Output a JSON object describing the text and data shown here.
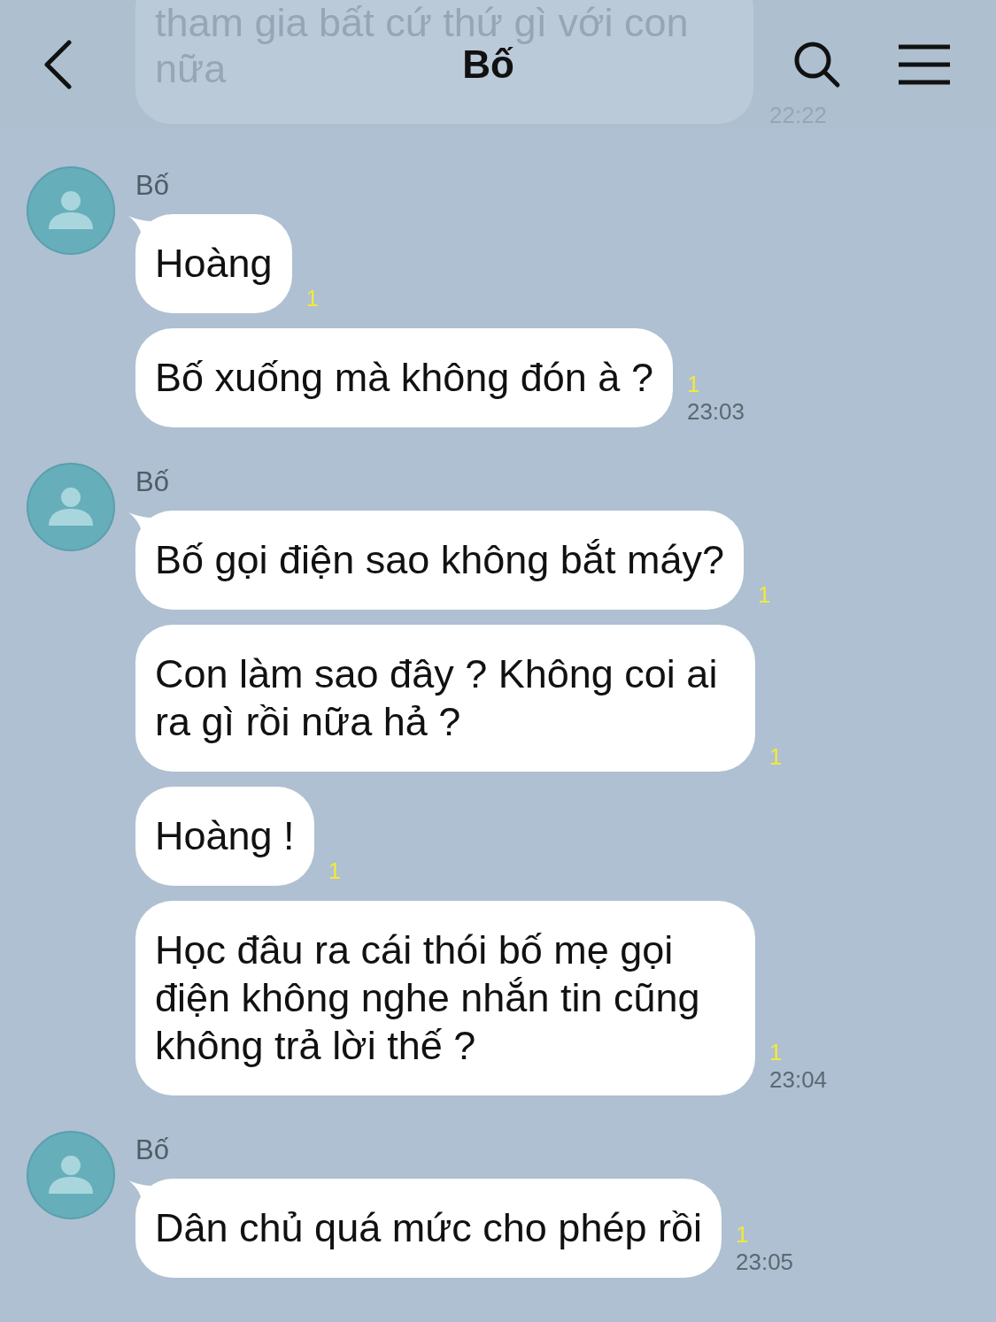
{
  "header": {
    "title": "Bố"
  },
  "previous_message": {
    "lines": [
      "tham gia bất cứ thứ gì với con",
      "nữa"
    ],
    "time": "22:22"
  },
  "groups": [
    {
      "sender": "Bố",
      "messages": [
        {
          "text": "Hoàng",
          "read_count": "1"
        },
        {
          "text": "Bố xuống mà không đón à ?",
          "read_count": "1",
          "time": "23:03"
        }
      ]
    },
    {
      "sender": "Bố",
      "messages": [
        {
          "text": "Bố gọi điện sao không bắt máy?",
          "read_count": "1"
        },
        {
          "text": "Con làm sao đây ? Không coi ai ra gì rồi nữa hả ?",
          "read_count": "1"
        },
        {
          "text": "Hoàng !",
          "read_count": "1"
        },
        {
          "text": "Học đâu ra cái thói bố mẹ gọi điện không nghe nhắn tin cũng không trả lời thế ?",
          "read_count": "1",
          "time": "23:04"
        }
      ]
    },
    {
      "sender": "Bố",
      "messages": [
        {
          "text": "Dân chủ quá mức cho phép rồi",
          "read_count": "1",
          "time": "23:05"
        }
      ]
    }
  ]
}
